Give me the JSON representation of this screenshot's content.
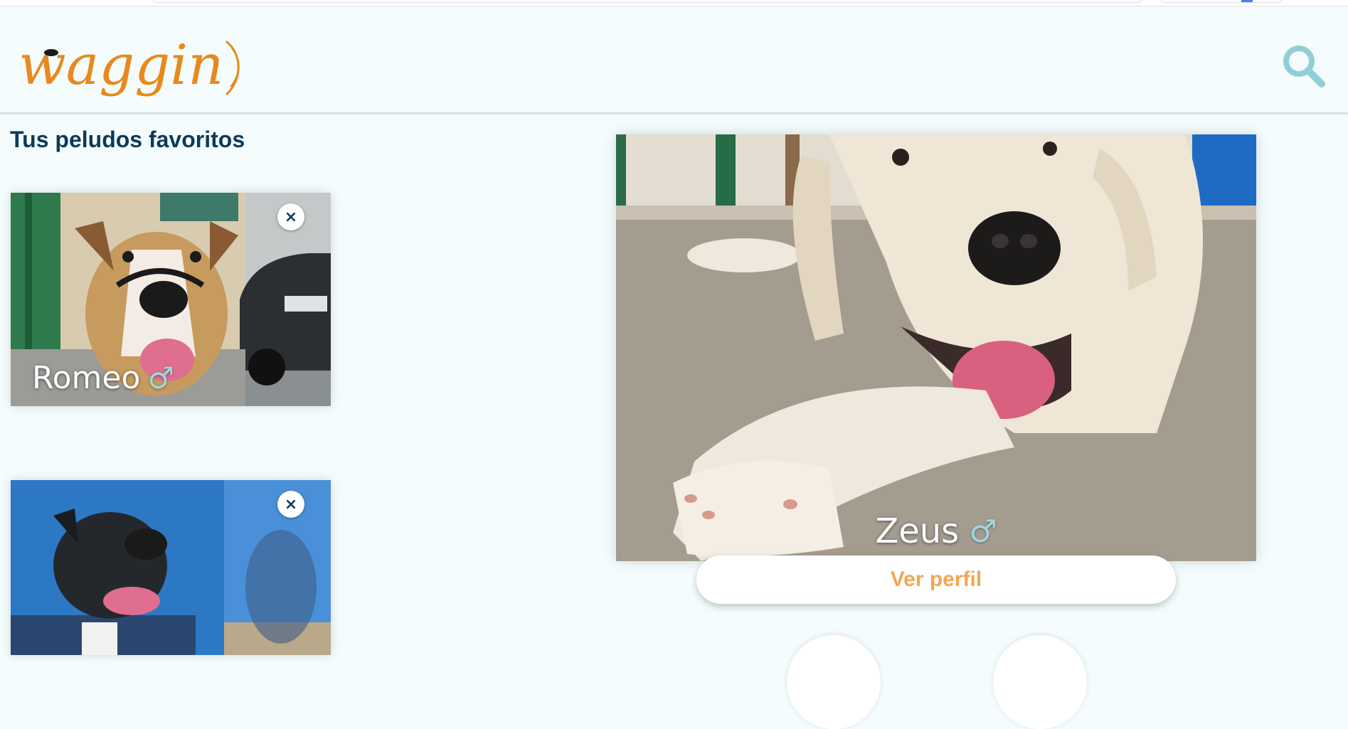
{
  "app": {
    "logo_text": "waggin",
    "search_label": "Buscar"
  },
  "favorites": {
    "title": "Tus peludos favoritos",
    "items": [
      {
        "name": "Romeo",
        "gender_symbol": "♂",
        "remove_symbol": "×"
      },
      {
        "name": "",
        "gender_symbol": "",
        "remove_symbol": "×"
      }
    ]
  },
  "featured": {
    "name": "Zeus",
    "gender_symbol": "♂",
    "profile_button": "Ver perfil"
  },
  "colors": {
    "background": "#f4fcfd",
    "title": "#0d3a5c",
    "logo_orange": "#e8891d",
    "search_icon": "#8fcfd6",
    "gender_icon": "#9fd6e0",
    "button_text": "#f5a556"
  },
  "icons": [
    "search-icon",
    "close-icon",
    "male-icon",
    "waggin-logo"
  ]
}
